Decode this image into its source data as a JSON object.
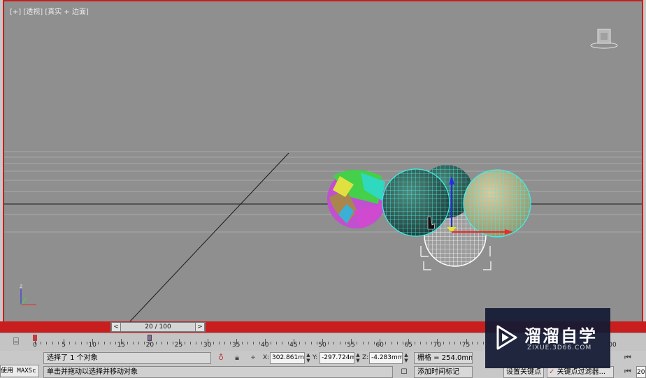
{
  "viewport": {
    "label": "[+] [透视] [真实 + 边面]"
  },
  "scrubber": {
    "left": "<",
    "right": ">",
    "frame_text": "20 / 100"
  },
  "timeline": {
    "ticks": [
      "0",
      "5",
      "10",
      "15",
      "20",
      "25",
      "30",
      "35",
      "40",
      "45",
      "50",
      "55",
      "60",
      "65",
      "70",
      "75"
    ],
    "current_frame": 20,
    "max_frame": 100,
    "end_label": "00"
  },
  "status": {
    "maxscript": "使用 MAXSc",
    "selection": "选择了 1 个对象",
    "hint": "单击并拖动以选择并移动对象",
    "x_label": "X:",
    "x_value": "302.861mr",
    "y_label": "Y:",
    "y_value": "-297.724m",
    "z_label": "Z:",
    "z_value": "-4.283mm",
    "grid": "栅格 = 254.0mm",
    "add_time_tag": "添加时间标记",
    "set_key": "设置关键点",
    "key_filters": "关键点过滤器...",
    "frame_field": "20"
  },
  "watermark": {
    "title": "溜溜自学",
    "subtitle": "ZIXUE.3D66.COM"
  },
  "colors": {
    "viewport_bg": "#8f8f8f",
    "active_border": "#c81e1e",
    "wire_cyan": "#3ff0e8",
    "watermark_bg": "#121a34"
  },
  "icons": {
    "viewcube": "viewcube-icon",
    "track_bar": "track-bar-icon",
    "select_lock": "lock-icon",
    "absolute_mode": "absolute-mode-icon",
    "isolate": "isolate-icon"
  }
}
